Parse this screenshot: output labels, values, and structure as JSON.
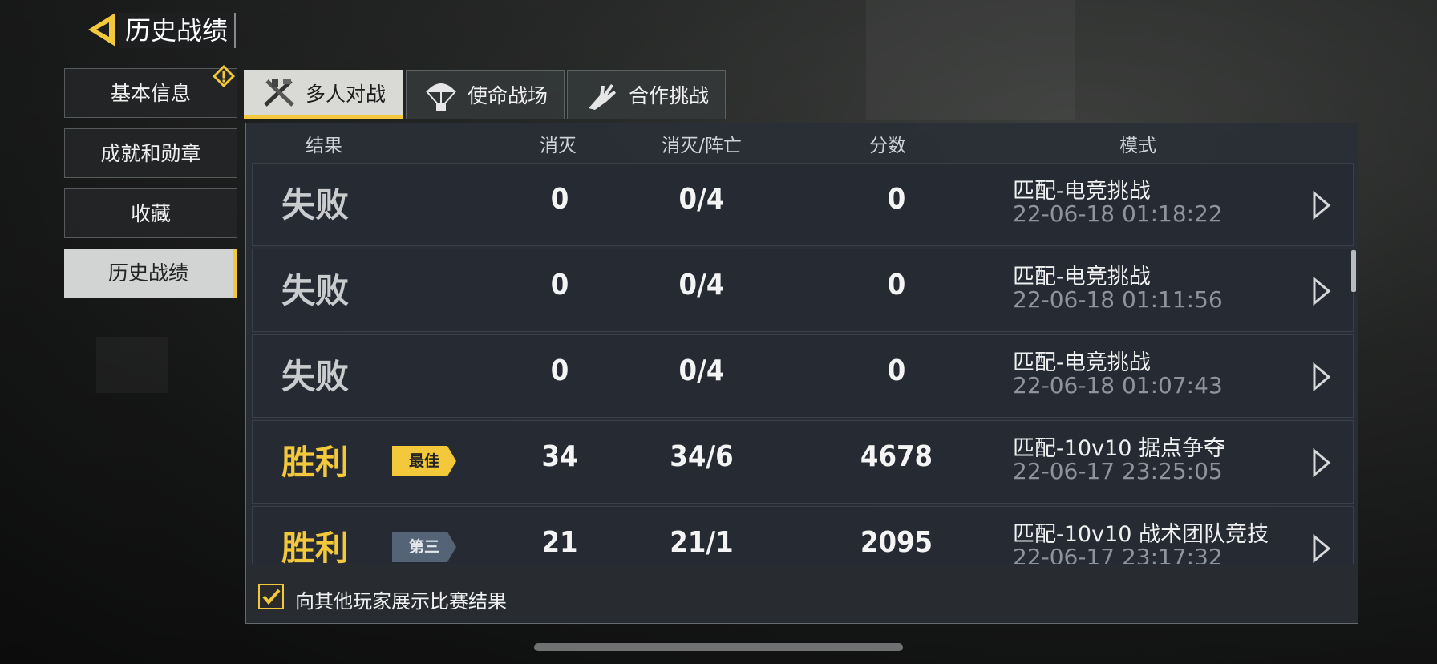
{
  "header": {
    "title": "历史战绩"
  },
  "sidebar": {
    "items": [
      {
        "label": "基本信息",
        "alert": true
      },
      {
        "label": "成就和勋章"
      },
      {
        "label": "收藏"
      },
      {
        "label": "历史战绩",
        "active": true
      }
    ]
  },
  "tabs": [
    {
      "label": "多人对战",
      "icon": "crossed-weapons-icon",
      "active": true
    },
    {
      "label": "使命战场",
      "icon": "parachute-icon"
    },
    {
      "label": "合作挑战",
      "icon": "zombie-hand-icon"
    }
  ],
  "table": {
    "headers": [
      "结果",
      "消灭",
      "消灭/阵亡",
      "分数",
      "模式"
    ],
    "rows": [
      {
        "result": "失败",
        "win": false,
        "badge": "",
        "kills": "0",
        "kd": "0/4",
        "score": "0",
        "mode": "匹配-电竞挑战",
        "time": "22-06-18 01:18:22"
      },
      {
        "result": "失败",
        "win": false,
        "badge": "",
        "kills": "0",
        "kd": "0/4",
        "score": "0",
        "mode": "匹配-电竞挑战",
        "time": "22-06-18 01:11:56"
      },
      {
        "result": "失败",
        "win": false,
        "badge": "",
        "kills": "0",
        "kd": "0/4",
        "score": "0",
        "mode": "匹配-电竞挑战",
        "time": "22-06-18 01:07:43"
      },
      {
        "result": "胜利",
        "win": true,
        "badge": "最佳",
        "kills": "34",
        "kd": "34/6",
        "score": "4678",
        "mode": "匹配-10v10 据点争夺",
        "time": "22-06-17 23:25:05"
      },
      {
        "result": "胜利",
        "win": true,
        "badge": "第三",
        "kills": "21",
        "kd": "21/1",
        "score": "2095",
        "mode": "匹配-10v10 战术团队竞技",
        "time": "22-06-17 23:17:32"
      }
    ]
  },
  "footer": {
    "checkbox_label": "向其他玩家展示比赛结果",
    "checked": true
  },
  "colors": {
    "accent": "#f3c83a",
    "panel": "#262b33",
    "third_badge": "#556376"
  }
}
